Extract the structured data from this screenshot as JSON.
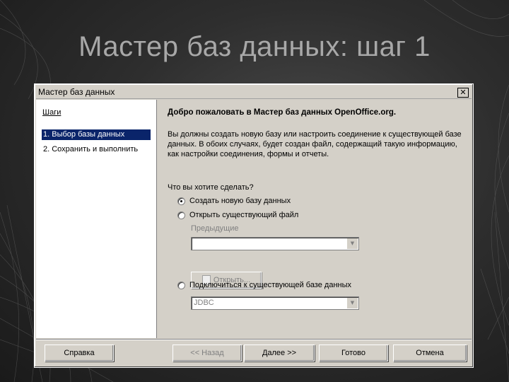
{
  "slide": {
    "title": "Мастер баз данных: шаг 1"
  },
  "window": {
    "title": "Мастер баз данных",
    "close_glyph": "✕"
  },
  "steps": {
    "heading": "Шаги",
    "items": [
      {
        "label": "1. Выбор базы данных",
        "active": true
      },
      {
        "label": "2. Сохранить и выполнить",
        "active": false
      }
    ]
  },
  "main": {
    "welcome": "Добро пожаловать в Мастер баз данных OpenOffice.org.",
    "description": "Вы должны создать новую базу или настроить соединение к существующей базе данных. В обоих случаях, будет создан файл, содержащий такую информацию, как настройки соединения, формы и отчеты.",
    "question": "Что вы хотите сделать?",
    "options": [
      {
        "label": "Создать новую базу данных",
        "checked": true
      },
      {
        "label": "Открыть существующий файл",
        "checked": false
      },
      {
        "label": "Подключиться к существующей базе данных",
        "checked": false
      }
    ],
    "recent_label": "Предыдущие",
    "recent_value": "",
    "open_button": "Открыть...",
    "connection_type_value": "JDBC"
  },
  "buttons": {
    "help": "Справка",
    "back": "<< Назад",
    "next": "Далее >>",
    "finish": "Готово",
    "cancel": "Отмена"
  }
}
